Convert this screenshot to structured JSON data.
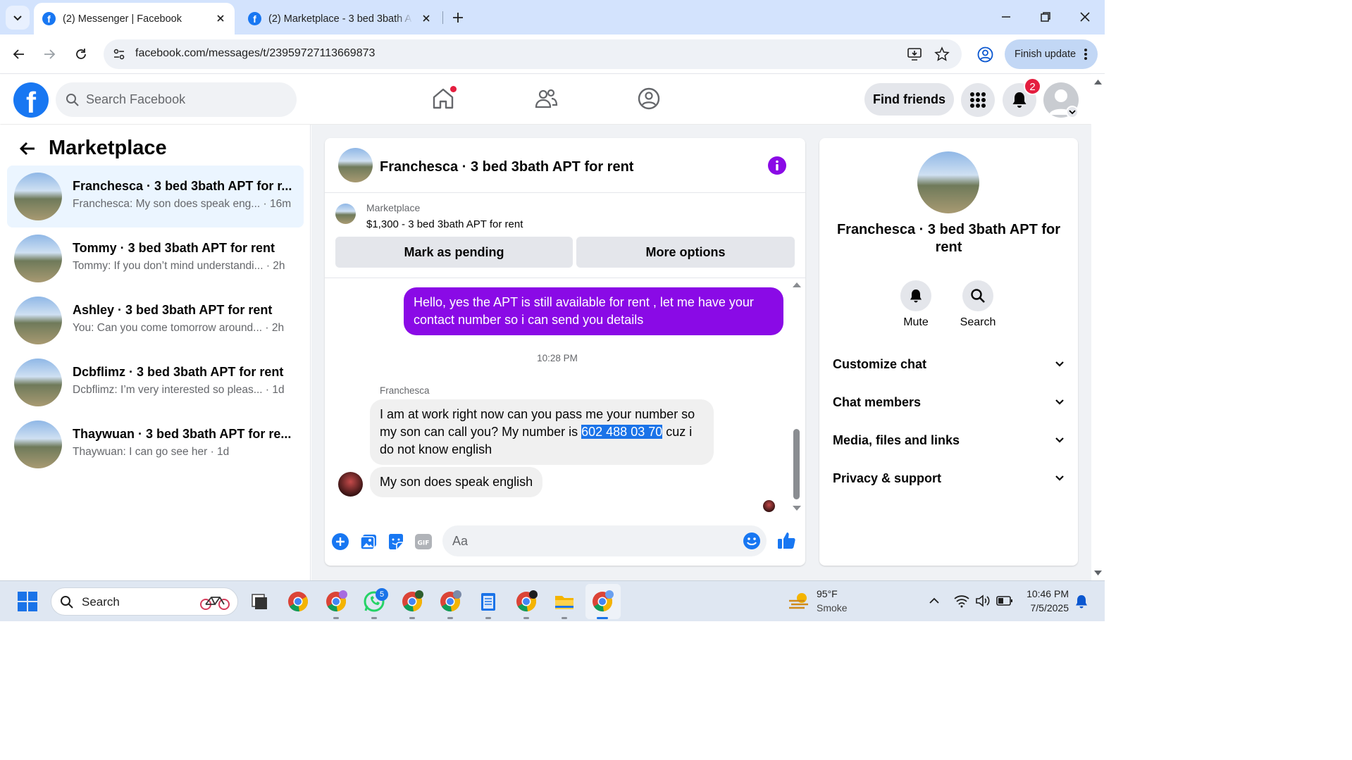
{
  "browser": {
    "tabs": [
      {
        "title": "(2) Messenger | Facebook",
        "active": true
      },
      {
        "title": "(2) Marketplace - 3 bed 3bath A",
        "active": false
      }
    ],
    "url": "facebook.com/messages/t/23959727113669873",
    "finish_update_label": "Finish update"
  },
  "fb_header": {
    "search_placeholder": "Search Facebook",
    "find_friends_label": "Find friends",
    "notification_count": "2"
  },
  "left_panel": {
    "title": "Marketplace",
    "conversations": [
      {
        "name": "Franchesca · 3 bed 3bath APT for r...",
        "preview": "Franchesca: My son does speak eng... · 16m",
        "selected": true
      },
      {
        "name": "Tommy · 3 bed 3bath APT for rent",
        "preview": "Tommy: If you don’t mind understandi... · 2h",
        "selected": false
      },
      {
        "name": "Ashley · 3 bed 3bath APT for rent",
        "preview": "You: Can you come tomorrow around... · 2h",
        "selected": false
      },
      {
        "name": "Dcbflimz · 3 bed 3bath APT for rent",
        "preview": "Dcbflimz: I’m very interested so pleas... · 1d",
        "selected": false
      },
      {
        "name": "Thaywuan · 3 bed 3bath APT for re...",
        "preview": "Thaywuan: I can go see her · 1d",
        "selected": false
      }
    ]
  },
  "chat": {
    "title": "Franchesca · 3 bed 3bath APT for rent",
    "listing_label": "Marketplace",
    "listing_price": "$1,300 - 3 bed 3bath APT for rent",
    "mark_pending_label": "Mark as pending",
    "more_options_label": "More options",
    "outgoing_message": "Hello, yes the APT is still available for  rent , let me have your contact number so i can send you details",
    "timestamp": "10:28 PM",
    "sender_name": "Franchesca",
    "incoming_1_part1": "I am at work right now can you pass me your number so my son can call you? My number is ",
    "incoming_1_highlight": "602 488 03 70",
    "incoming_1_part2": " cuz i do not know english",
    "incoming_2": "My son does speak english",
    "composer_placeholder": "Aa"
  },
  "right_panel": {
    "name": "Franchesca · 3 bed 3bath APT for rent",
    "mute_label": "Mute",
    "search_label": "Search",
    "sections": [
      "Customize chat",
      "Chat members",
      "Media, files and links",
      "Privacy & support"
    ]
  },
  "taskbar": {
    "search_placeholder": "Search",
    "whatsapp_badge": "5",
    "weather_temp": "95°F",
    "weather_desc": "Smoke",
    "time": "10:46 PM",
    "date": "7/5/2025"
  },
  "colors": {
    "fb_blue": "#1877f2",
    "outgoing_bubble": "#8a0ae6",
    "selected_conv": "#ebf5ff",
    "chrome_tabbar": "#d3e3fd"
  }
}
